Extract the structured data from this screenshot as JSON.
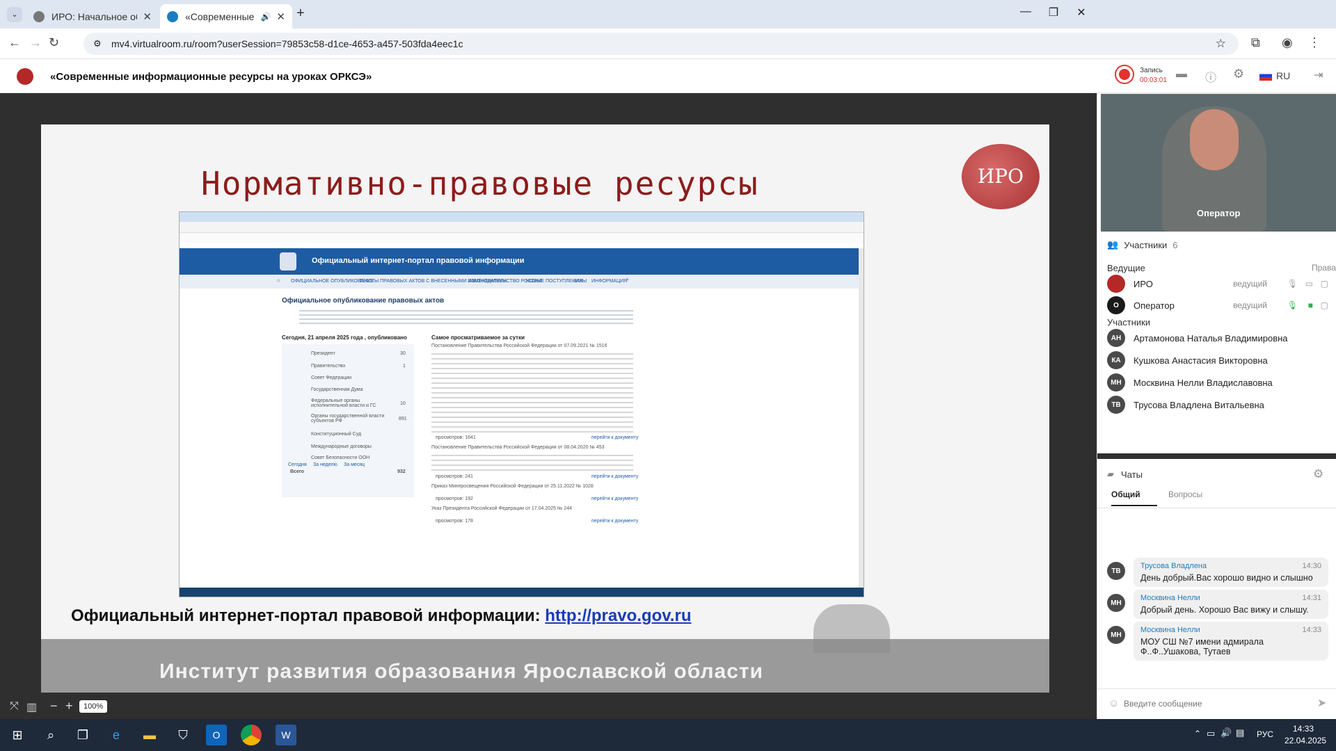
{
  "browser": {
    "tabs": [
      {
        "title": "ИРО: Начальное образование",
        "active": false
      },
      {
        "title": "«Современные информац",
        "active": true
      }
    ],
    "url": "mv4.virtualroom.ru/room?userSession=79853c58-d1ce-4653-a457-503fda4eec1c"
  },
  "room": {
    "title": "«Современные информационные ресурсы на уроках ОРКСЭ»",
    "record_label": "Запись",
    "record_time": "00:03:01",
    "lang": "RU"
  },
  "slide": {
    "title": "Нормативно-правовые ресурсы",
    "logo_text": "ИРО",
    "caption_prefix": "Официальный интернет-портал правовой информации:",
    "caption_link": "http://pravo.gov.ru",
    "footer": "Институт развития образования Ярославской области",
    "embedded": {
      "banner": "Официальный интернет-портал правовой информации",
      "menu": [
        "ОФИЦИАЛЬНОЕ ОПУБЛИКОВАНИЕ",
        "ТЕКСТЫ ПРАВОВЫХ АКТОВ С ВНЕСЕННЫМИ ИЗМЕНЕНИЯМИ",
        "ЗАКОНОДАТЕЛЬСТВО РОССИИ",
        "НОВЫЕ ПОСТУПЛЕНИЯ",
        "ЗАКЫ",
        "ИНФОРМАЦИЯ"
      ],
      "heading": "Официальное опубликование правовых актов",
      "today_heading": "Сегодня, 21 апреля 2025 года , опубликовано",
      "popular_heading": "Самое просматриваемое за сутки",
      "categories": [
        {
          "name": "Президент",
          "count": "30"
        },
        {
          "name": "Правительство",
          "count": "1"
        },
        {
          "name": "Совет Федерации",
          "count": ""
        },
        {
          "name": "Государственная Дума",
          "count": ""
        },
        {
          "name": "Федеральные органы исполнительной власти и ГС",
          "count": "10"
        },
        {
          "name": "Органы государственной власти субъектов РФ",
          "count": "891"
        },
        {
          "name": "Конституционный Суд",
          "count": ""
        },
        {
          "name": "Международные договоры",
          "count": ""
        },
        {
          "name": "Совет Безопасности ООН",
          "count": ""
        },
        {
          "name": "Всего",
          "count": "932"
        }
      ],
      "tabs": [
        "Сегодня",
        "За неделю",
        "За месяц"
      ],
      "popular": [
        {
          "title": "Постановление Правительства Российской Федерации от 07.09.2021 № 1516",
          "views": "просмотров: 1641",
          "link": "перейти к документу"
        },
        {
          "title": "Постановление Правительства Российской Федерации от 08.04.2020 № 453",
          "views": "просмотров: 241",
          "link": "перейти к документу"
        },
        {
          "title": "Приказ Минпросвещения Российской Федерации от 25.11.2022 № 1028",
          "views": "просмотров: 192",
          "link": "перейти к документу"
        },
        {
          "title": "Указ Президента Российской Федерации от 17.04.2025 № 244",
          "views": "просмотров: 178",
          "link": "перейти к документу"
        }
      ]
    }
  },
  "zoom": "100%",
  "video": {
    "label": "Оператор"
  },
  "participants": {
    "header": "Участники",
    "count": "6",
    "hosts_label": "Ведущие",
    "rights_label": "Права",
    "hosts": [
      {
        "initials": "",
        "name": "ИРО",
        "role": "ведущий",
        "color": "#ffffff"
      },
      {
        "initials": "О",
        "name": "Оператор",
        "role": "ведущий",
        "color": "#1a1a1a"
      }
    ],
    "members_label": "Участники",
    "members": [
      {
        "initials": "АН",
        "name": "Артамонова Наталья Владимировна",
        "color": "#4a4a4a"
      },
      {
        "initials": "КА",
        "name": "Кушкова Анастасия Викторовна",
        "color": "#4a4a4a"
      },
      {
        "initials": "МН",
        "name": "Москвина Нелли Владиславовна",
        "color": "#4a4a4a"
      },
      {
        "initials": "ТВ",
        "name": "Трусова Владлена Витальевна",
        "color": "#4a4a4a"
      }
    ]
  },
  "chats": {
    "header": "Чаты",
    "tabs": [
      "Общий",
      "Вопросы"
    ],
    "messages": [
      {
        "initials": "ТВ",
        "name": "Трусова Владлена",
        "time": "14:30",
        "text": "День добрый.Вас хорошо видно и слышно"
      },
      {
        "initials": "МН",
        "name": "Москвина Нелли",
        "time": "14:31",
        "text": "Добрый день. Хорошо Вас вижу и слышу."
      },
      {
        "initials": "МН",
        "name": "Москвина Нелли",
        "time": "14:33",
        "text": "МОУ СШ №7 имени адмирала Ф..Ф..Ушакова, Тутаев"
      }
    ],
    "placeholder": "Введите сообщение"
  },
  "taskbar": {
    "lang": "РУС",
    "time": "14:33",
    "date": "22.04.2025"
  }
}
